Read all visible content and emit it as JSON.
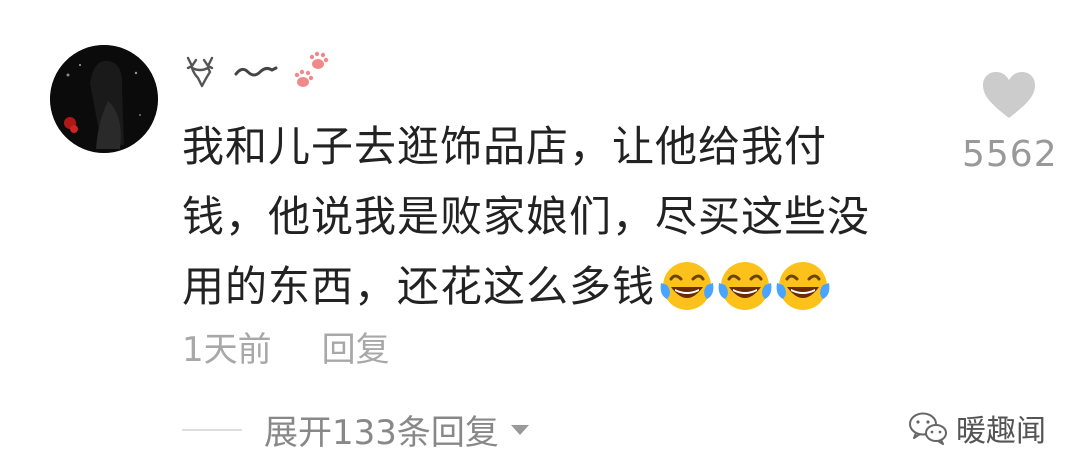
{
  "comment": {
    "user": {
      "avatar_icon": "avatar-dark-portrait",
      "name_icons": [
        "deer-head-icon",
        "tilde-wave-icon",
        "paw-prints-icon"
      ]
    },
    "text": "我和儿子去逛饰品店，让他给我付钱，他说我是败家娘们，尽买这些没用的东西，还花这么多钱",
    "emojis": [
      "tears-of-joy-emoji",
      "tears-of-joy-emoji",
      "tears-of-joy-emoji"
    ],
    "time": "1天前",
    "reply_label": "回复",
    "likes": "5562",
    "like_icon": "heart-icon",
    "expand_label": "展开133条回复",
    "expand_icon": "caret-down-icon"
  },
  "watermark": {
    "icon": "wechat-icon",
    "text": "暖趣闻"
  },
  "colors": {
    "text": "#222222",
    "muted": "#a8a8a8",
    "like": "#cccccc",
    "paw": "#f08a8a"
  }
}
